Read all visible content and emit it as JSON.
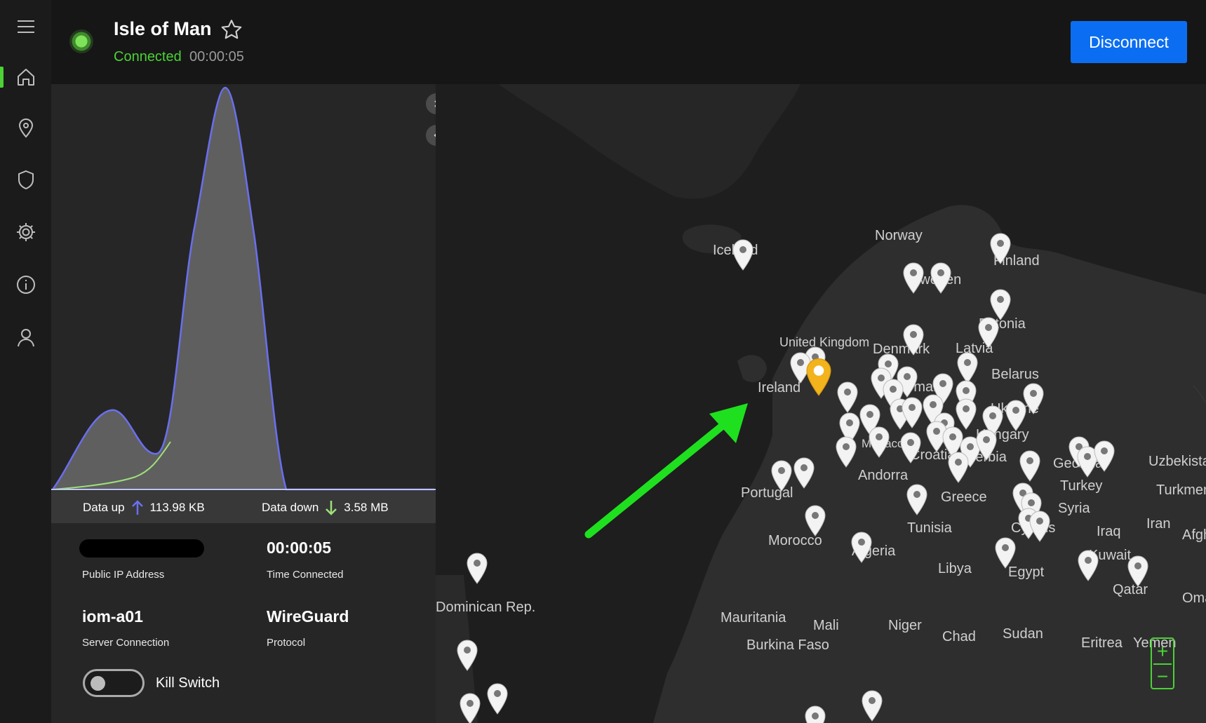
{
  "header": {
    "server_name": "Isle of Man",
    "status": "Connected",
    "elapsed": "00:00:05",
    "disconnect_label": "Disconnect"
  },
  "sidebar": {
    "items": [
      {
        "name": "home",
        "icon": "home-icon"
      },
      {
        "name": "locations",
        "icon": "location-pin-icon"
      },
      {
        "name": "security",
        "icon": "shield-icon"
      },
      {
        "name": "settings",
        "icon": "gear-icon"
      },
      {
        "name": "info",
        "icon": "info-icon"
      },
      {
        "name": "account",
        "icon": "user-icon"
      }
    ]
  },
  "stats": {
    "data_up_label": "Data up",
    "data_up_value": "113.98 KB",
    "data_down_label": "Data down",
    "data_down_value": "3.58 MB",
    "time_value": "00:00:05",
    "time_label": "Time Connected",
    "ip_label": "Public IP Address",
    "server_value": "iom-a01",
    "server_label": "Server Connection",
    "protocol_value": "WireGuard",
    "protocol_label": "Protocol",
    "kill_switch_label": "Kill Switch"
  },
  "map": {
    "countries": [
      "Iceland",
      "Norway",
      "Finland",
      "Sweden",
      "Estonia",
      "Latvia",
      "Denmark",
      "United Kingdom",
      "Ireland",
      "Belarus",
      "Germany",
      "Ukraine",
      "Hungary",
      "Croatia",
      "Serbia",
      "Andorra",
      "Portugal",
      "Monaco",
      "Georgia",
      "Uzbekistan",
      "Turkey",
      "Turkmenistan",
      "Greece",
      "Syria",
      "Iran",
      "Afghanistan",
      "Tunisia",
      "Cyprus",
      "Iraq",
      "Morocco",
      "Algeria",
      "Libya",
      "Egypt",
      "Kuwait",
      "Qatar",
      "Oman",
      "Dominican Rep.",
      "Mauritania",
      "Mali",
      "Niger",
      "Chad",
      "Sudan",
      "Burkina Faso",
      "Eritrea",
      "Yemen"
    ],
    "zoom_in": "+",
    "zoom_out": "−"
  },
  "colors": {
    "accent_green": "#4cd137",
    "button_blue": "#0b6ef2",
    "selected_pin": "#f2b31c",
    "upload_line": "#6a6ff0",
    "download_line": "#9ee07a"
  }
}
